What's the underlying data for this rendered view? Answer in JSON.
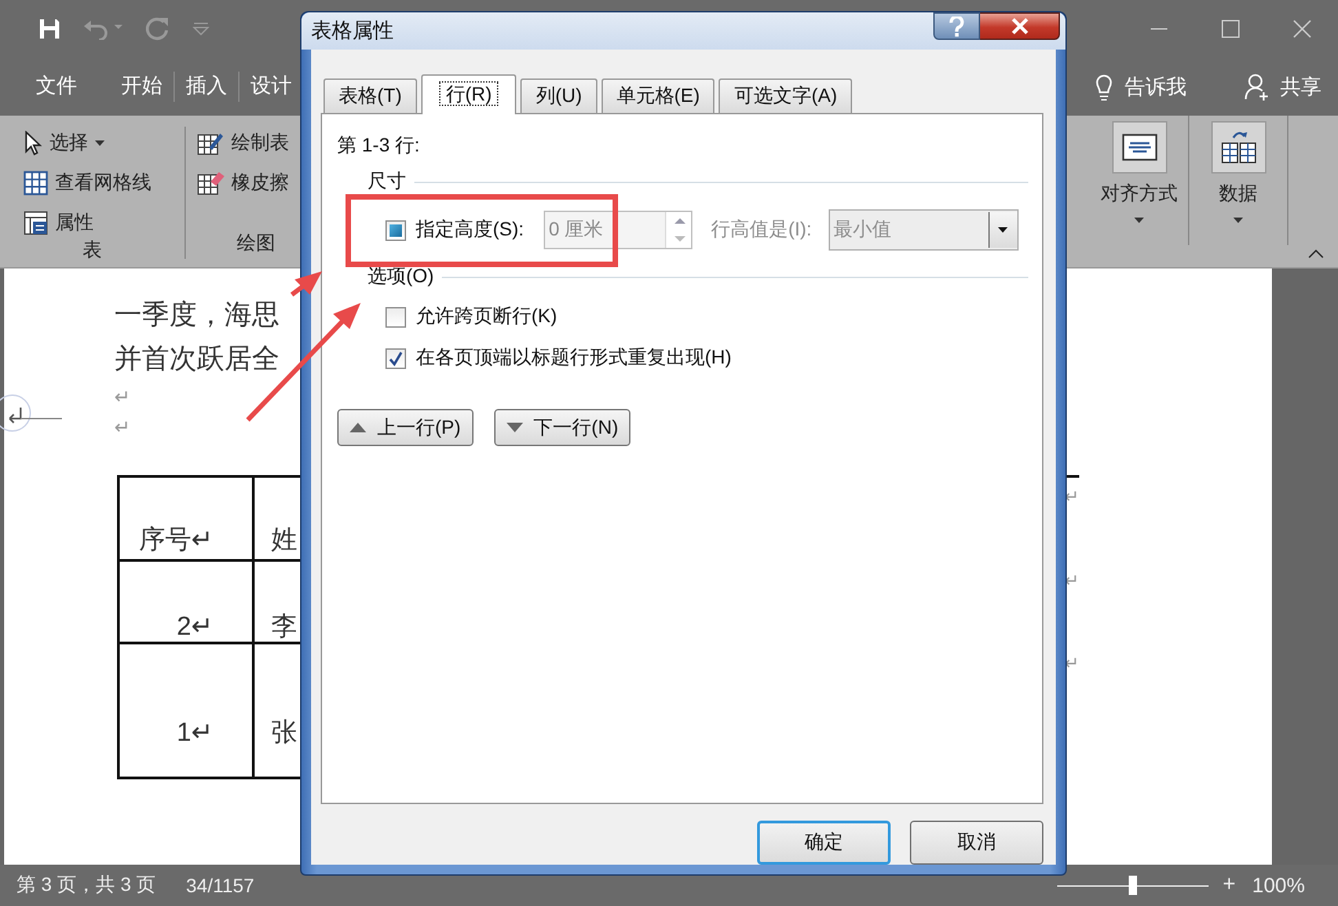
{
  "ribbon_tabs": [
    "文件",
    "开始",
    "插入",
    "设计"
  ],
  "tell_me": "告诉我",
  "share": "共享",
  "ribbon_left_groups": [
    {
      "label": "表",
      "items": [
        {
          "label": "选择",
          "kind": "pointer",
          "dropdown": true
        },
        {
          "label": "查看网格线",
          "kind": "grid",
          "dropdown": false
        },
        {
          "label": "属性",
          "kind": "properties",
          "dropdown": false
        }
      ]
    },
    {
      "label": "绘图",
      "items": [
        {
          "label": "绘制表",
          "kind": "pencil",
          "dropdown": false
        },
        {
          "label": "橡皮擦",
          "kind": "eraser",
          "dropdown": false
        }
      ]
    }
  ],
  "ribbon_right_groups": [
    {
      "label": "对齐方式",
      "kind": "align"
    },
    {
      "label": "数据",
      "kind": "data"
    }
  ],
  "document": {
    "lines": [
      "一季度，海思",
      "并首次跃居全"
    ],
    "paragraph_marks": [
      "↵",
      "↵"
    ],
    "table_rows": [
      {
        "cells": [
          "序号↵",
          "姓"
        ],
        "end_mark": "↵"
      },
      {
        "cells": [
          "2↵",
          "李"
        ],
        "end_mark": "↵"
      },
      {
        "cells": [
          "1↵",
          "张"
        ],
        "end_mark": "↵"
      }
    ]
  },
  "status_bar": {
    "page": "第 3 页，共 3 页",
    "words": "34/1157",
    "zoom_in": "+",
    "zoom": "100%",
    "zoom_slider": {
      "level": 0.5
    }
  },
  "dialog": {
    "title": "表格属性",
    "tabs": [
      {
        "label": "表格(T)",
        "selected": false
      },
      {
        "label": "行(R)",
        "selected": true
      },
      {
        "label": "列(U)",
        "selected": false
      },
      {
        "label": "单元格(E)",
        "selected": false
      },
      {
        "label": "可选文字(A)",
        "selected": false
      }
    ],
    "rows_heading": "第 1-3 行:",
    "size_group": {
      "label": "尺寸",
      "height_checkbox": {
        "label": "指定高度(S):",
        "checked": false,
        "indeterminate": true
      },
      "height_field": {
        "value": "0 厘米",
        "disabled": true
      },
      "rule_label": {
        "text": "行高值是(I):",
        "disabled": true
      },
      "rule_select": {
        "value": "最小值",
        "disabled": true
      }
    },
    "options_group": {
      "label": "选项(O)",
      "checkboxes": [
        {
          "label": "允许跨页断行(K)",
          "checked": false
        },
        {
          "label": "在各页顶端以标题行形式重复出现(H)",
          "checked": true
        }
      ]
    },
    "nav_buttons": [
      {
        "label": "上一行(P)",
        "kind": "up"
      },
      {
        "label": "下一行(N)",
        "kind": "down"
      }
    ],
    "buttons": [
      {
        "label": "确定",
        "default": true
      },
      {
        "label": "取消",
        "default": false
      }
    ]
  }
}
